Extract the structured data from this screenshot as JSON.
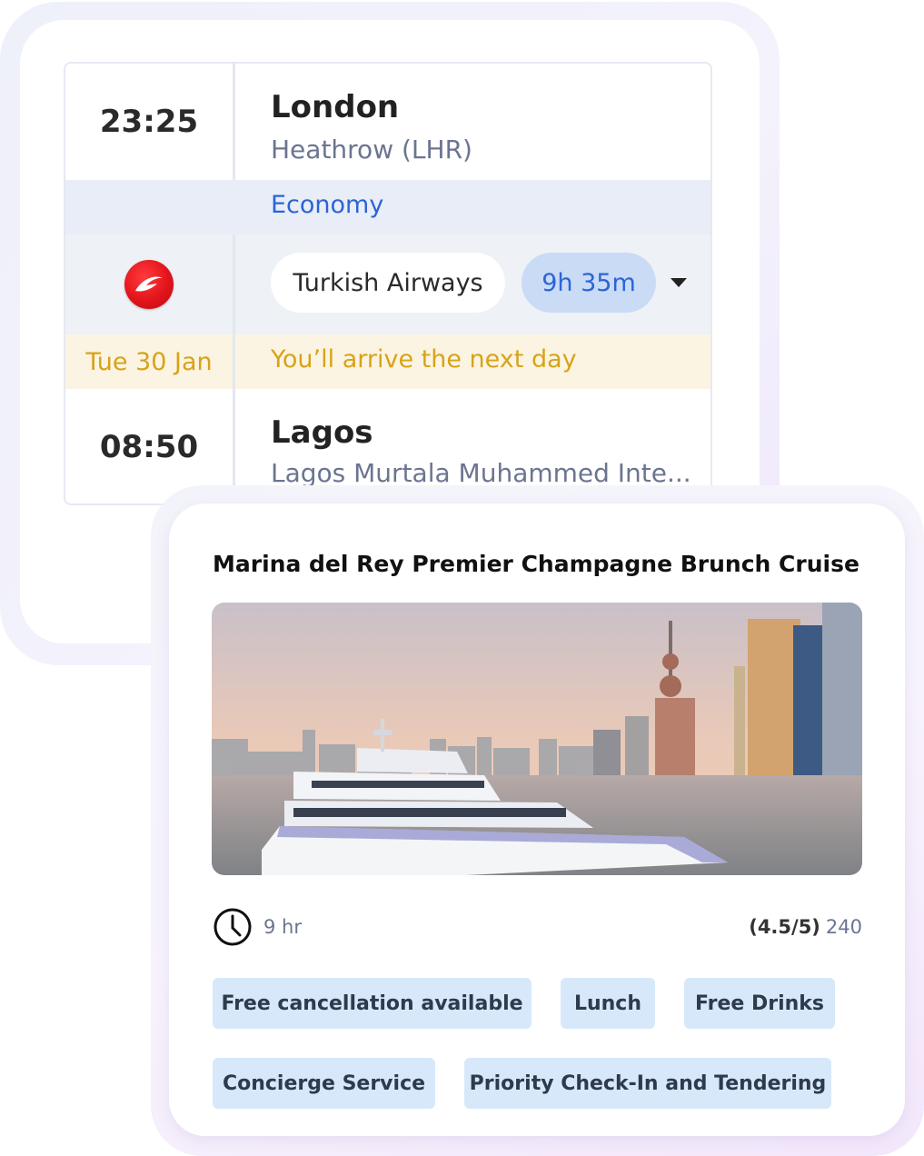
{
  "flight": {
    "departure": {
      "time": "23:25",
      "city": "London",
      "airport": "Heathrow (LHR)"
    },
    "cabin_class": "Economy",
    "airline": {
      "logo_icon": "turkish-airlines-logo",
      "name": "Turkish Airways",
      "duration": "9h 35m",
      "expand_icon": "caret-down-icon"
    },
    "arrival_notice": {
      "date": "Tue 30 Jan",
      "message": "You’ll arrive the next day"
    },
    "arrival": {
      "time": "08:50",
      "city": "Lagos",
      "airport": "Lagos Murtala Muhammed Inte..."
    }
  },
  "tour": {
    "title": "Marina del Rey Premier Champagne Brunch Cruise",
    "image": "city-skyline-cruise-yacht-photo",
    "duration_icon": "clock-icon",
    "duration": "9 hr",
    "rating": "(4.5/5)",
    "reviews": "240",
    "tags": [
      "Free cancellation available",
      "Lunch",
      "Free Drinks",
      "Concierge Service",
      "Priority Check-In and Tendering"
    ]
  },
  "colors": {
    "accent_blue": "#2c64d6",
    "class_band": "#e8edf7",
    "notice_band": "#fcf4e2",
    "notice_text": "#d7a318",
    "tag_bg": "#d7e8fb",
    "airline_red": "#e2141b"
  }
}
